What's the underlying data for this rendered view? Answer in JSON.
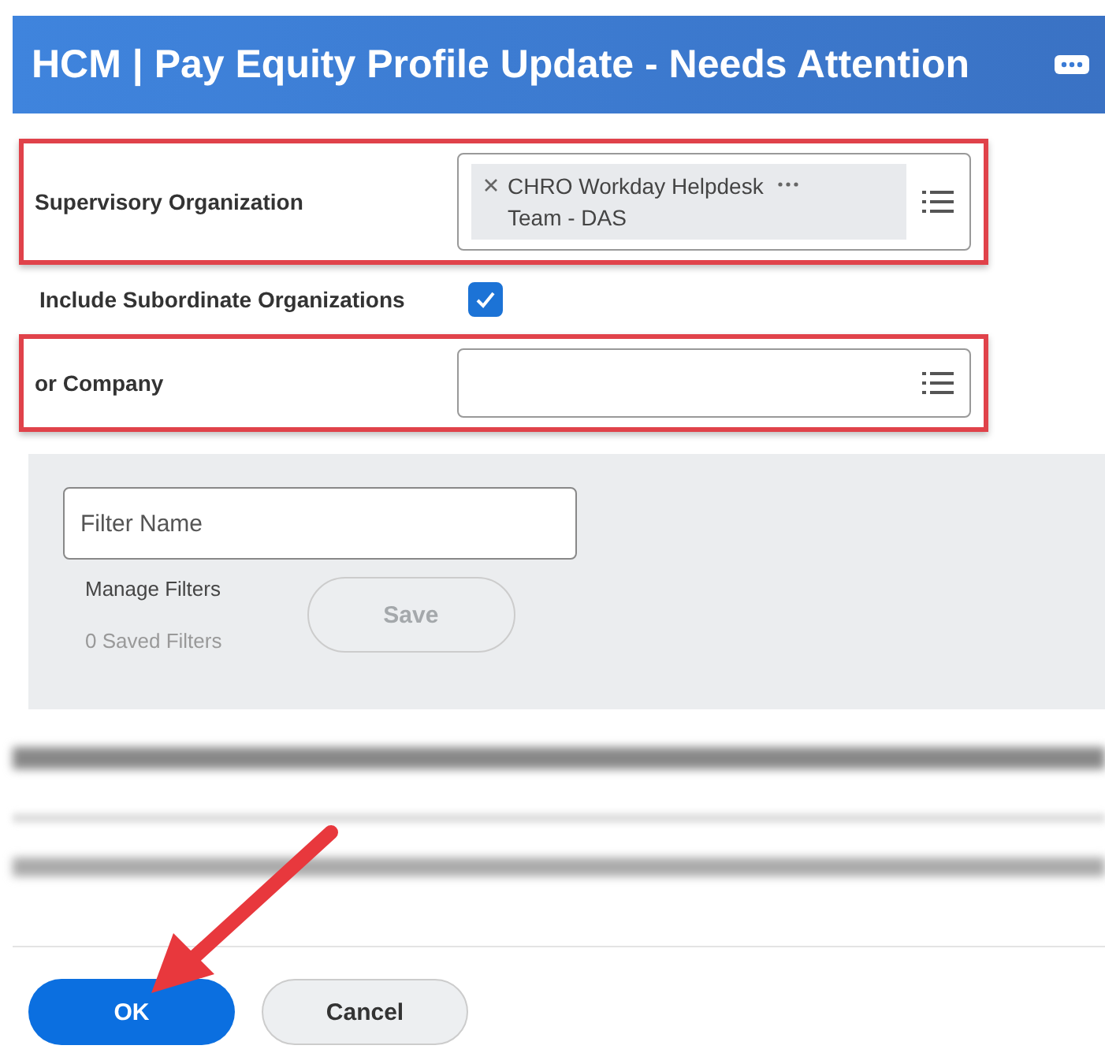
{
  "header": {
    "title": "HCM | Pay Equity Profile Update - Needs Attention"
  },
  "fields": [
    {
      "kind": "prompt",
      "label": "Supervisory Organization",
      "highlighted": true,
      "chips": [
        "CHRO Workday Helpdesk Team - DAS"
      ]
    },
    {
      "kind": "checkbox",
      "label": "Include Subordinate Organizations",
      "checked": true
    },
    {
      "kind": "prompt",
      "label": "or Company",
      "highlighted": true
    }
  ],
  "filter_panel": {
    "placeholder": "Filter Name",
    "manage_label": "Manage Filters",
    "saved_count": "0 Saved Filters",
    "save_button": {
      "label": "Save",
      "disabled": true
    }
  },
  "buttons": [
    {
      "label": "OK",
      "primary": true
    },
    {
      "label": "Cancel",
      "primary": false
    }
  ]
}
